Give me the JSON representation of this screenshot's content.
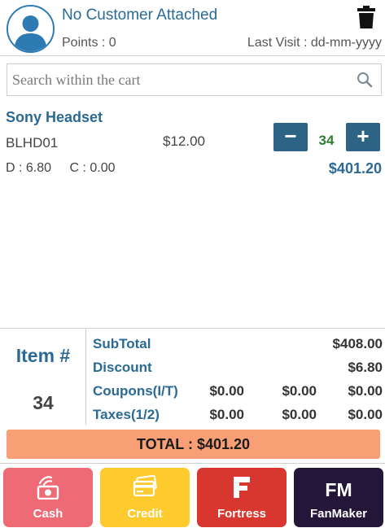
{
  "customer": {
    "name": "No Customer Attached",
    "points_label": "Points : 0",
    "last_visit_label": "Last Visit : dd-mm-yyyy"
  },
  "search": {
    "placeholder": "Search within the cart"
  },
  "cart_item": {
    "name": "Sony Headset",
    "sku": "BLHD01",
    "price": "$12.00",
    "discount": "D : 6.80",
    "coupon": "C : 0.00",
    "quantity": "34",
    "minus_label": "−",
    "plus_label": "+",
    "line_total": "$401.20"
  },
  "summary": {
    "item_label": "Item #",
    "item_count": "34",
    "subtotal_label": "SubTotal",
    "subtotal_value": "$408.00",
    "discount_label": "Discount",
    "discount_value": "$6.80",
    "coupons_label": "Coupons(I/T)",
    "coupons_values": [
      "$0.00",
      "$0.00",
      "$0.00"
    ],
    "taxes_label": "Taxes(1/2)",
    "taxes_values": [
      "$0.00",
      "$0.00",
      "$0.00"
    ]
  },
  "total_label": "TOTAL : $401.20",
  "payments": {
    "cash": "Cash",
    "credit": "Credit",
    "fortress": "Fortress",
    "fanmaker": "FanMaker",
    "fanmaker_logo": "FM",
    "fortress_logo": "F"
  },
  "colors": {
    "accent_blue": "#2a6a94",
    "button_blue": "#2d6486",
    "qty_green": "#2e7d32",
    "total_bar": "#f99f76",
    "cash": "#ee6b75",
    "credit": "#fecb2e",
    "fortress": "#d8372f",
    "fanmaker": "#241638"
  },
  "icons": [
    "avatar-icon",
    "trash-icon",
    "search-icon",
    "cash-icon",
    "credit-card-icon"
  ]
}
